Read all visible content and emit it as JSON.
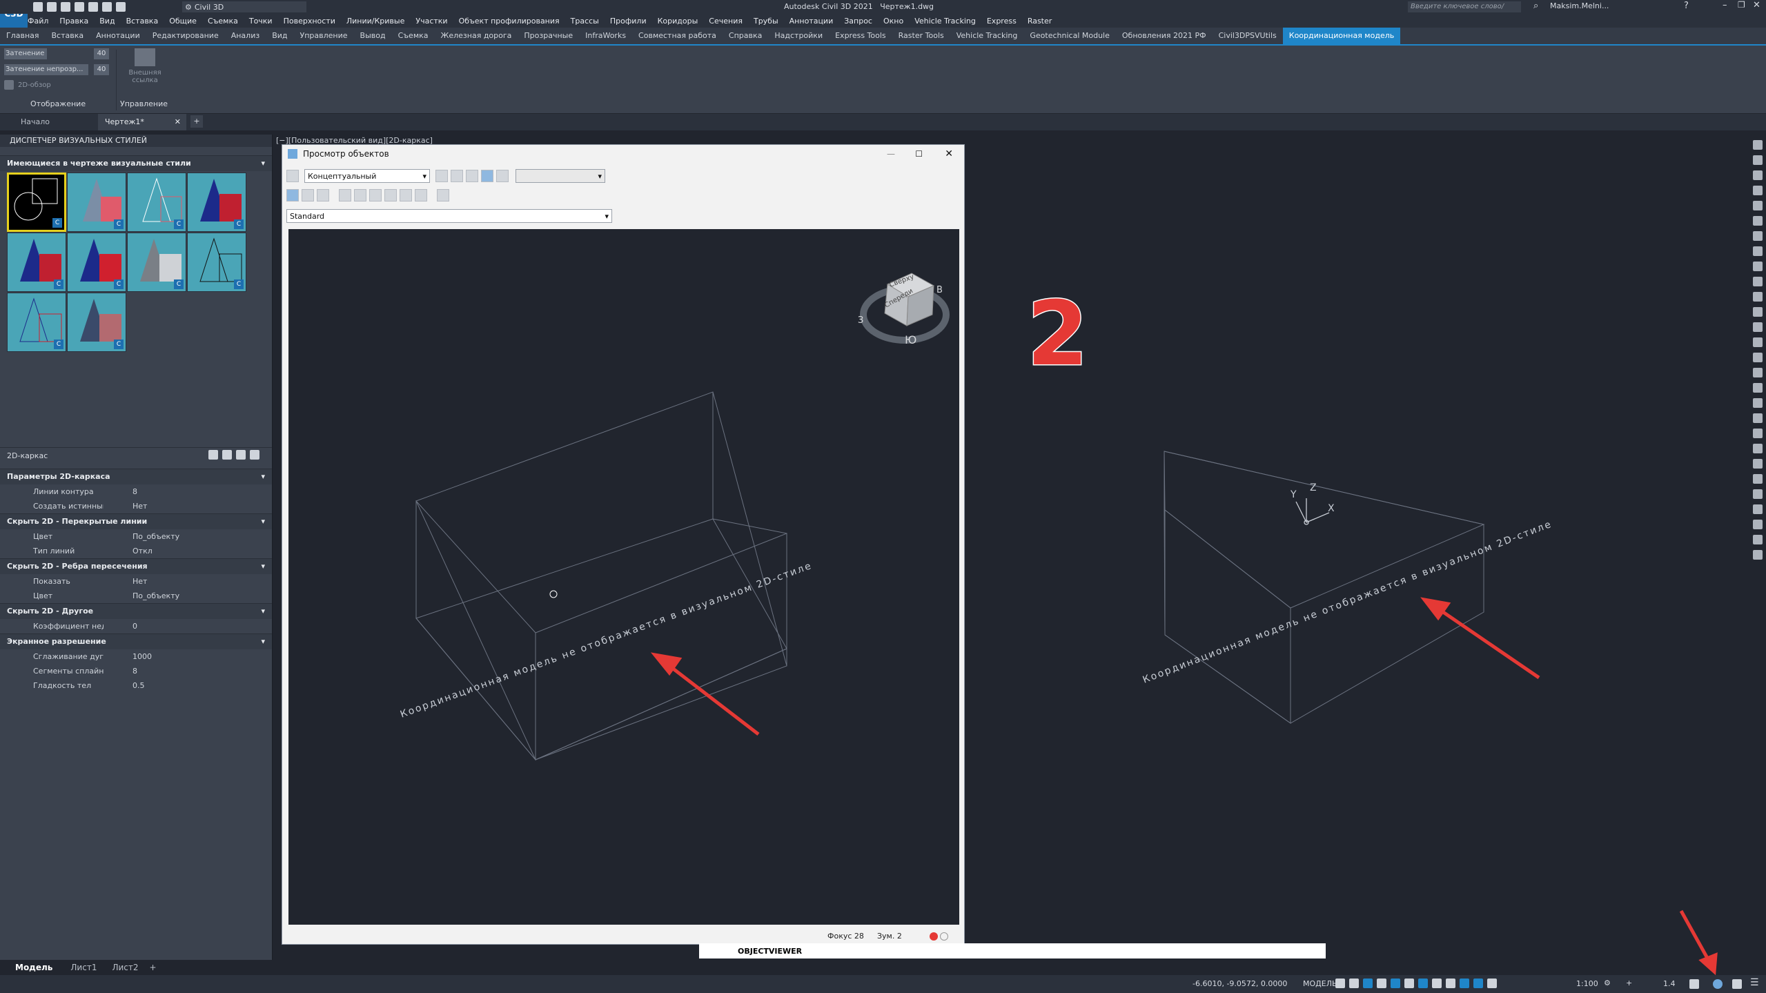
{
  "app": {
    "logo": "C3D",
    "title": "Autodesk Civil 3D 2021",
    "file_title": "Чертеж1.dwg",
    "workspace": "Civil 3D",
    "search_placeholder": "Введите ключевое слово/фразу",
    "user": "Maksim.Melni..."
  },
  "menu": [
    "Файл",
    "Правка",
    "Вид",
    "Вставка",
    "Общие",
    "Съемка",
    "Точки",
    "Поверхности",
    "Линии/Кривые",
    "Участки",
    "Объект профилирования",
    "Трассы",
    "Профили",
    "Коридоры",
    "Сечения",
    "Трубы",
    "Аннотации",
    "Запрос",
    "Окно",
    "Vehicle Tracking",
    "Express",
    "Raster"
  ],
  "ribbon_tabs": [
    "Главная",
    "Вставка",
    "Аннотации",
    "Редактирование",
    "Анализ",
    "Вид",
    "Управление",
    "Вывод",
    "Съемка",
    "Железная дорога",
    "Прозрачные",
    "InfraWorks",
    "Совместная работа",
    "Справка",
    "Надстройки",
    "Express Tools",
    "Raster Tools",
    "Vehicle Tracking",
    "Geotechnical Module",
    "Обновления 2021 РФ",
    "Civil3DPSVUtils",
    "Координационная модель"
  ],
  "ribbon_active": "Координационная модель",
  "ribbon": {
    "row1_label": "Затенение цвета",
    "row1_value": "40",
    "row2_label": "Затенение непрозр...",
    "row2_value": "40",
    "row3_label": "2D-обзор",
    "btn_external": "Внешняя ссылка",
    "group1": "Отображение",
    "group2": "Управление"
  },
  "doc_tabs": [
    "Начало",
    "Чертеж1*"
  ],
  "viewport_label": "[−][Пользовательский вид][2D-каркас]",
  "palette": {
    "title": "ДИСПЕТЧЕР ВИЗУАЛЬНЫХ СТИЛЕЙ",
    "styles_header": "Имеющиеся в чертеже визуальные стили",
    "current_style": "2D-каркас",
    "sections": [
      {
        "title": "Параметры 2D-каркаса",
        "rows": [
          {
            "k": "Линии контура",
            "v": "8"
          },
          {
            "k": "Создать истинный сил...",
            "v": "Нет"
          }
        ]
      },
      {
        "title": "Скрыть 2D - Перекрытые линии",
        "rows": [
          {
            "k": "Цвет",
            "v": "По_объекту"
          },
          {
            "k": "Тип линий",
            "v": "Откл"
          }
        ]
      },
      {
        "title": "Скрыть 2D - Ребра пересечения",
        "rows": [
          {
            "k": "Показать",
            "v": "Нет"
          },
          {
            "k": "Цвет",
            "v": "По_объекту"
          }
        ]
      },
      {
        "title": "Скрыть 2D - Другое",
        "rows": [
          {
            "k": "Коэффициент недовод...",
            "v": "0"
          }
        ]
      },
      {
        "title": "Экранное разрешение",
        "rows": [
          {
            "k": "Сглаживание дуги/окр...",
            "v": "1000"
          },
          {
            "k": "Сегменты сплайна",
            "v": "8"
          },
          {
            "k": "Гладкость тел",
            "v": "0.5"
          }
        ]
      }
    ]
  },
  "viewer": {
    "title": "Просмотр объектов",
    "visual_style": "Концептуальный",
    "view_select": "Standard",
    "status_focus": "Фокус 28",
    "status_zoom": "Зум. 2",
    "cube_top": "Сверху",
    "cube_front": "Спереди",
    "compass_s": "Ю",
    "compass_w": "З",
    "compass_e": "В"
  },
  "drawing": {
    "text": "Координационная модель не отображается в визуальном 2D-стиле",
    "number": "2",
    "ucs_x": "X",
    "ucs_y": "Y",
    "ucs_z": "Z"
  },
  "cmdline": {
    "command": "OBJECTVIEWER"
  },
  "layout_tabs": [
    "Модель",
    "Лист1",
    "Лист2"
  ],
  "status": {
    "coords": "-6.6010, -9.0572, 0.0000",
    "mode": "МОДЕЛЬ",
    "scale": "1:100",
    "lineweight": "1.4"
  },
  "colors": {
    "accent": "#1f86c9",
    "arrow": "#e53935",
    "canvas": "#21252e"
  }
}
